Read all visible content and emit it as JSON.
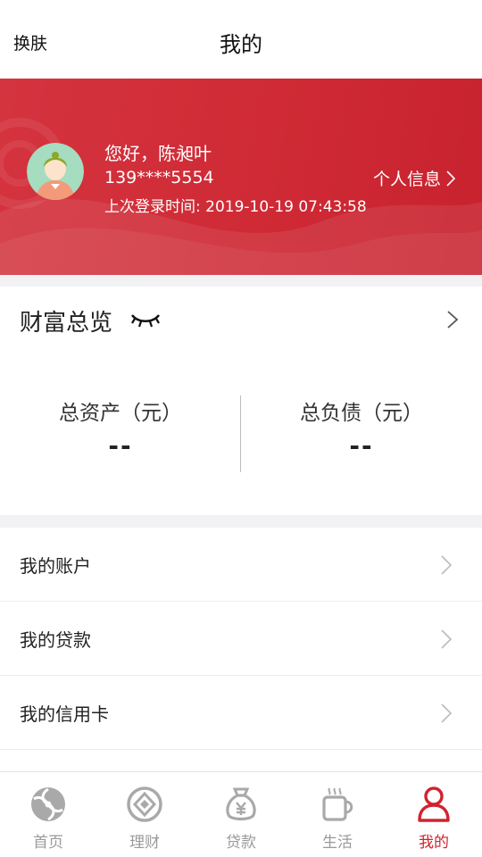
{
  "header": {
    "skin_label": "换肤",
    "title": "我的"
  },
  "user": {
    "greeting": "您好，陈昶叶",
    "phone": "139****5554",
    "last_login": "上次登录时间: 2019-10-19 07:43:58",
    "profile_link": "个人信息",
    "avatar_icon": "user-avatar-icon"
  },
  "wealth": {
    "title": "财富总览",
    "visibility_icon": "eye-closed-icon",
    "total_assets_label": "总资产（元）",
    "total_assets_value": "--",
    "total_liabilities_label": "总负债（元）",
    "total_liabilities_value": "--"
  },
  "menu": {
    "items": [
      {
        "label": "我的账户"
      },
      {
        "label": "我的贷款"
      },
      {
        "label": "我的信用卡"
      }
    ]
  },
  "tabs": [
    {
      "label": "首页",
      "icon": "home-swirl-icon",
      "active": false
    },
    {
      "label": "理财",
      "icon": "wealth-coin-icon",
      "active": false
    },
    {
      "label": "贷款",
      "icon": "money-bag-icon",
      "active": false
    },
    {
      "label": "生活",
      "icon": "coffee-cup-icon",
      "active": false
    },
    {
      "label": "我的",
      "icon": "person-icon",
      "active": true
    }
  ],
  "colors": {
    "brand_red": "#d1232f",
    "inactive_gray": "#9a9a9a",
    "background": "#f2f1f4"
  }
}
